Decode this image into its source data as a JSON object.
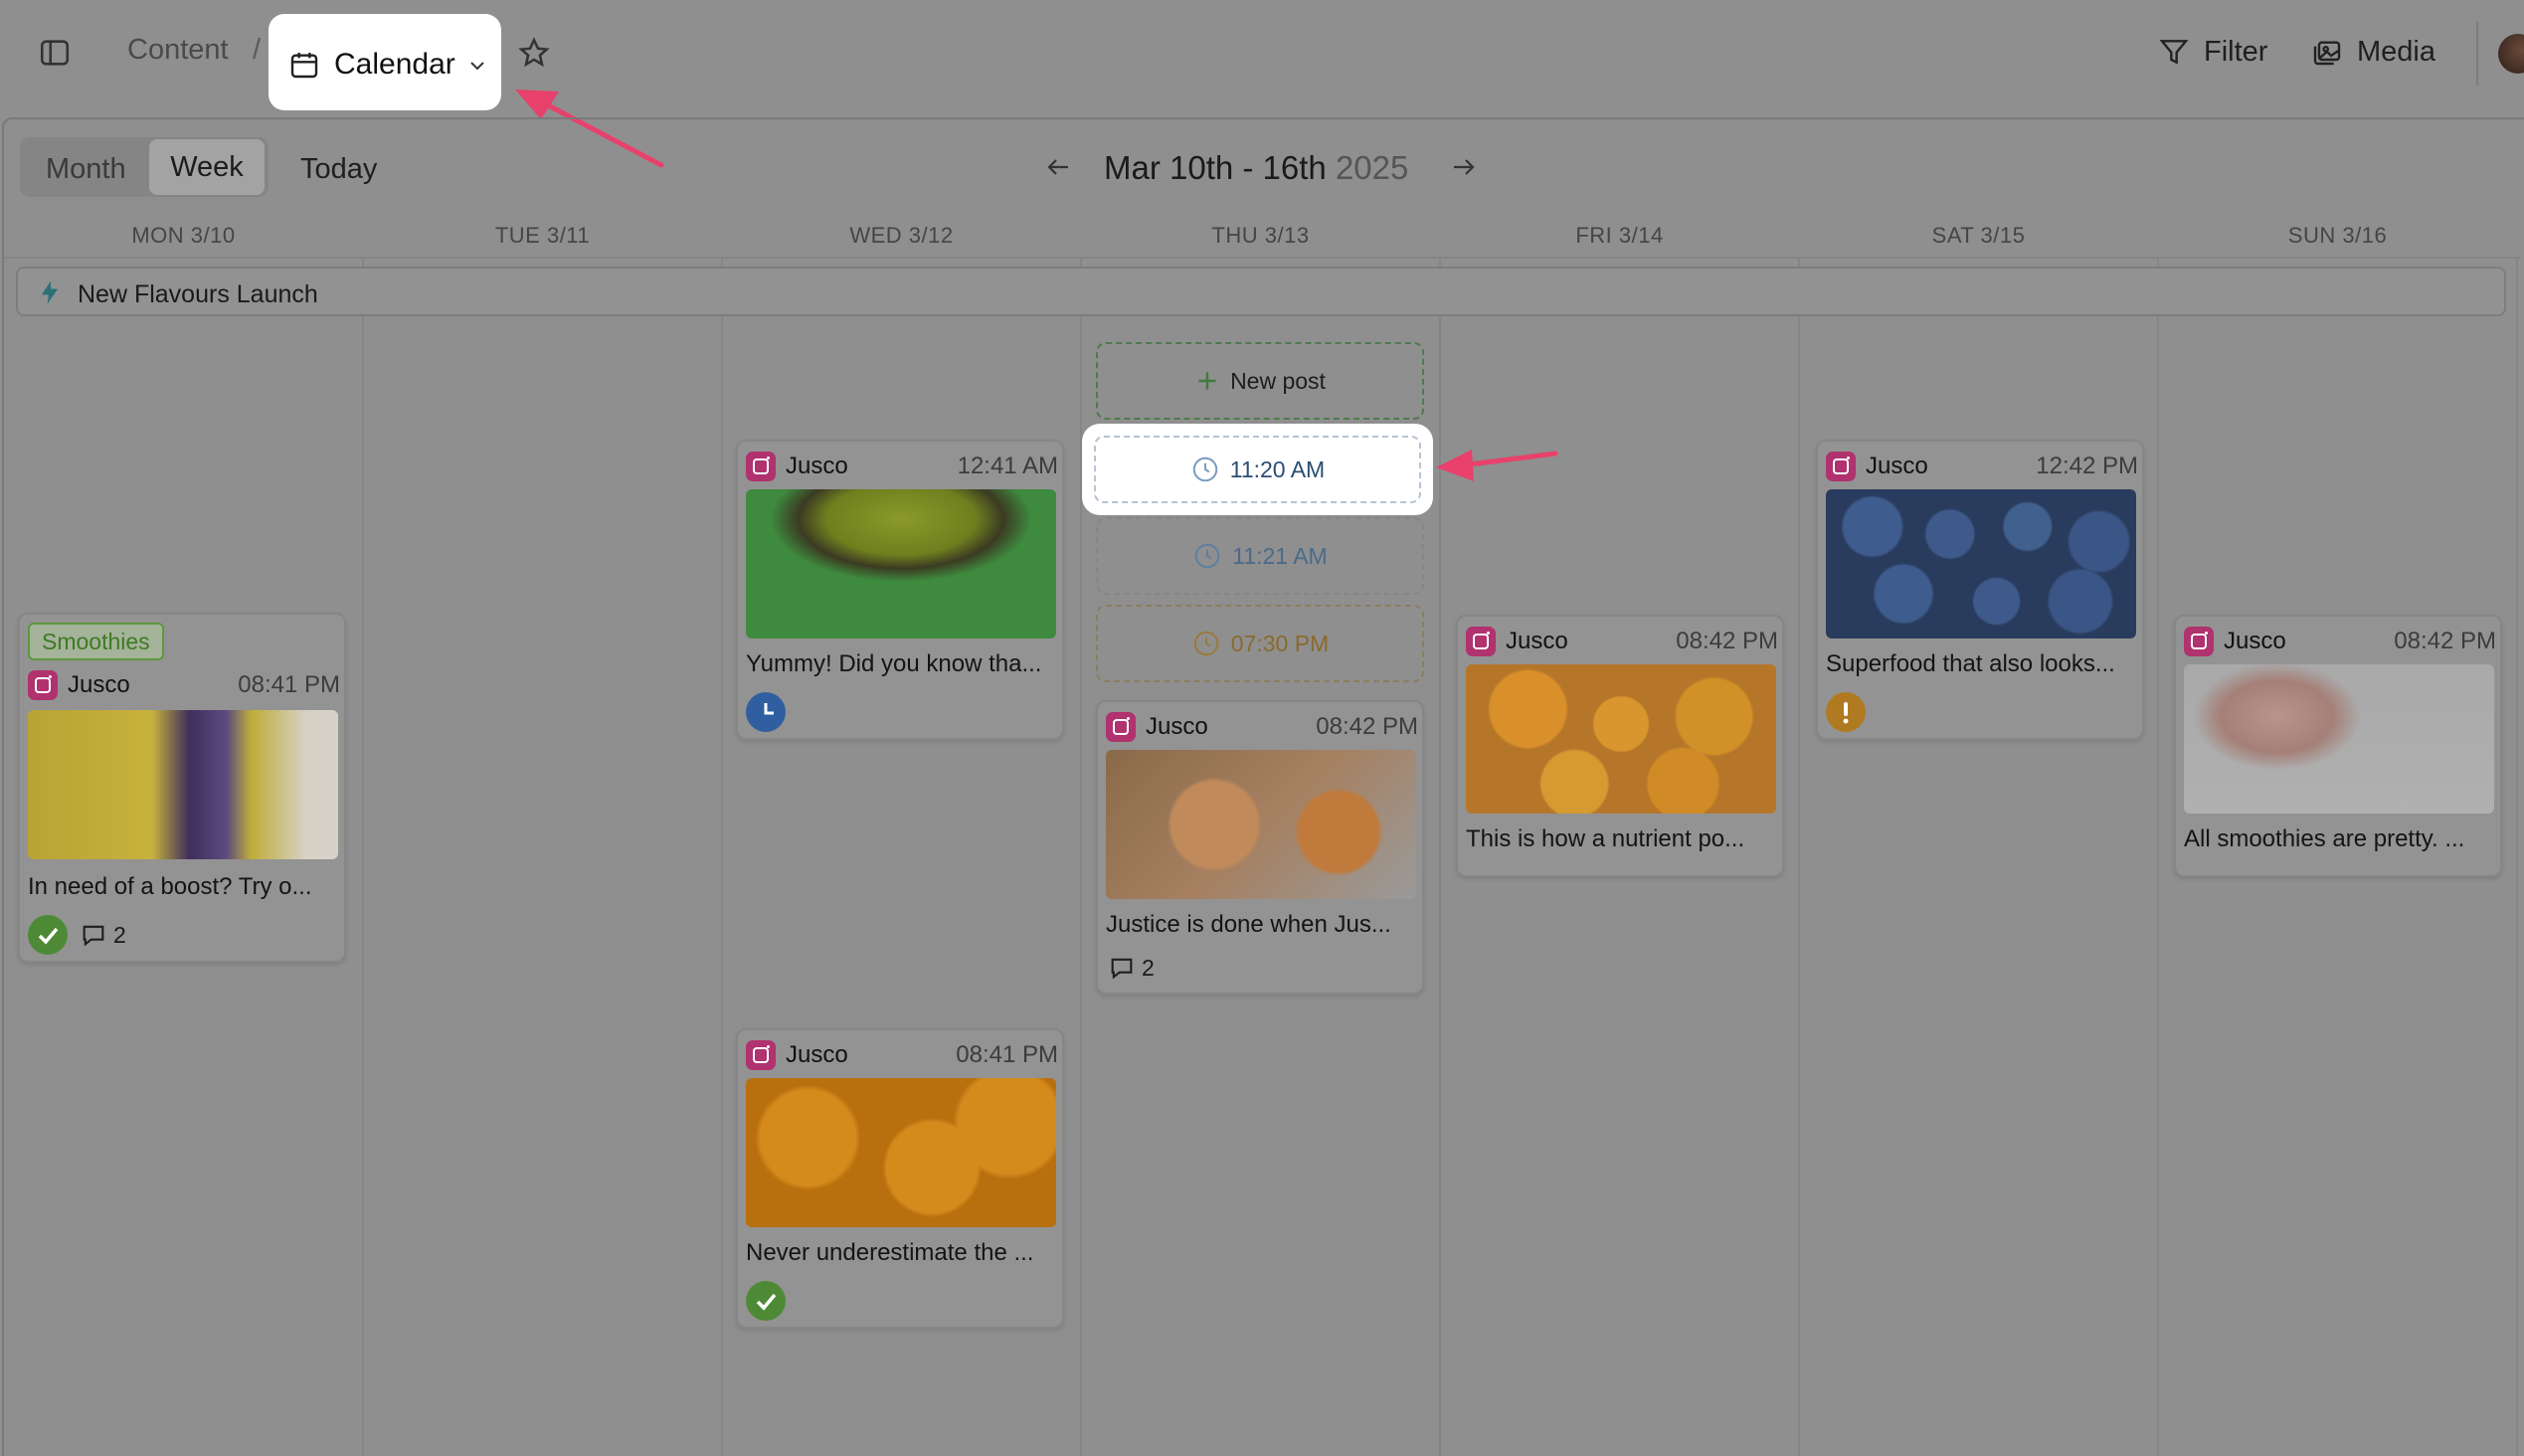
{
  "topbar": {
    "breadcrumb_root": "Content",
    "breadcrumb_sep": "/",
    "current_view": "Calendar",
    "filter_label": "Filter",
    "media_label": "Media"
  },
  "toolbar": {
    "month_label": "Month",
    "week_label": "Week",
    "today_label": "Today",
    "range_label": "Mar 10th - 16th",
    "range_year": "2025",
    "active_view": "Week"
  },
  "days": [
    {
      "label": "MON 3/10"
    },
    {
      "label": "TUE 3/11"
    },
    {
      "label": "WED 3/12"
    },
    {
      "label": "THU 3/13"
    },
    {
      "label": "FRI 3/14"
    },
    {
      "label": "SAT 3/15"
    },
    {
      "label": "SUN 3/16"
    }
  ],
  "campaign": {
    "label": "New Flavours Launch"
  },
  "slots": {
    "new_post": "New post",
    "active": "11:20 AM",
    "slot2": "11:21 AM",
    "slot3": "07:30 PM"
  },
  "posts": [
    {
      "tag": "Smoothies",
      "account": "Jusco",
      "time": "08:41 PM",
      "caption": "In need of a boost? Try o...",
      "status": "approved",
      "comments": "2"
    },
    {
      "account": "Jusco",
      "time": "12:41 AM",
      "caption": "Yummy! Did you know tha...",
      "status": "scheduled"
    },
    {
      "account": "Jusco",
      "time": "08:41 PM",
      "caption": "Never underestimate the ...",
      "status": "approved"
    },
    {
      "account": "Jusco",
      "time": "08:42 PM",
      "caption": "Justice is done when Jus...",
      "comments": "2"
    },
    {
      "account": "Jusco",
      "time": "08:42 PM",
      "caption": "This is how a nutrient po..."
    },
    {
      "account": "Jusco",
      "time": "12:42 PM",
      "caption": "Superfood that also looks...",
      "status": "warning"
    },
    {
      "account": "Jusco",
      "time": "08:42 PM",
      "caption": "All smoothies are pretty. ..."
    }
  ],
  "colors": {
    "accent_arrow": "#e8416b",
    "approved": "#4e8a36",
    "scheduled": "#2f5fa0",
    "warning": "#b07a20",
    "instagram": "#b0326e"
  },
  "icons": {
    "sidebar_toggle": "sidebar-toggle-icon",
    "calendar": "calendar-icon",
    "star": "star-icon",
    "filter": "filter-icon",
    "media": "media-icon",
    "bolt": "bolt-icon",
    "clock": "clock-icon",
    "plus": "plus-icon",
    "comment": "comment-icon",
    "check": "check-icon",
    "exclamation": "exclamation-icon"
  }
}
